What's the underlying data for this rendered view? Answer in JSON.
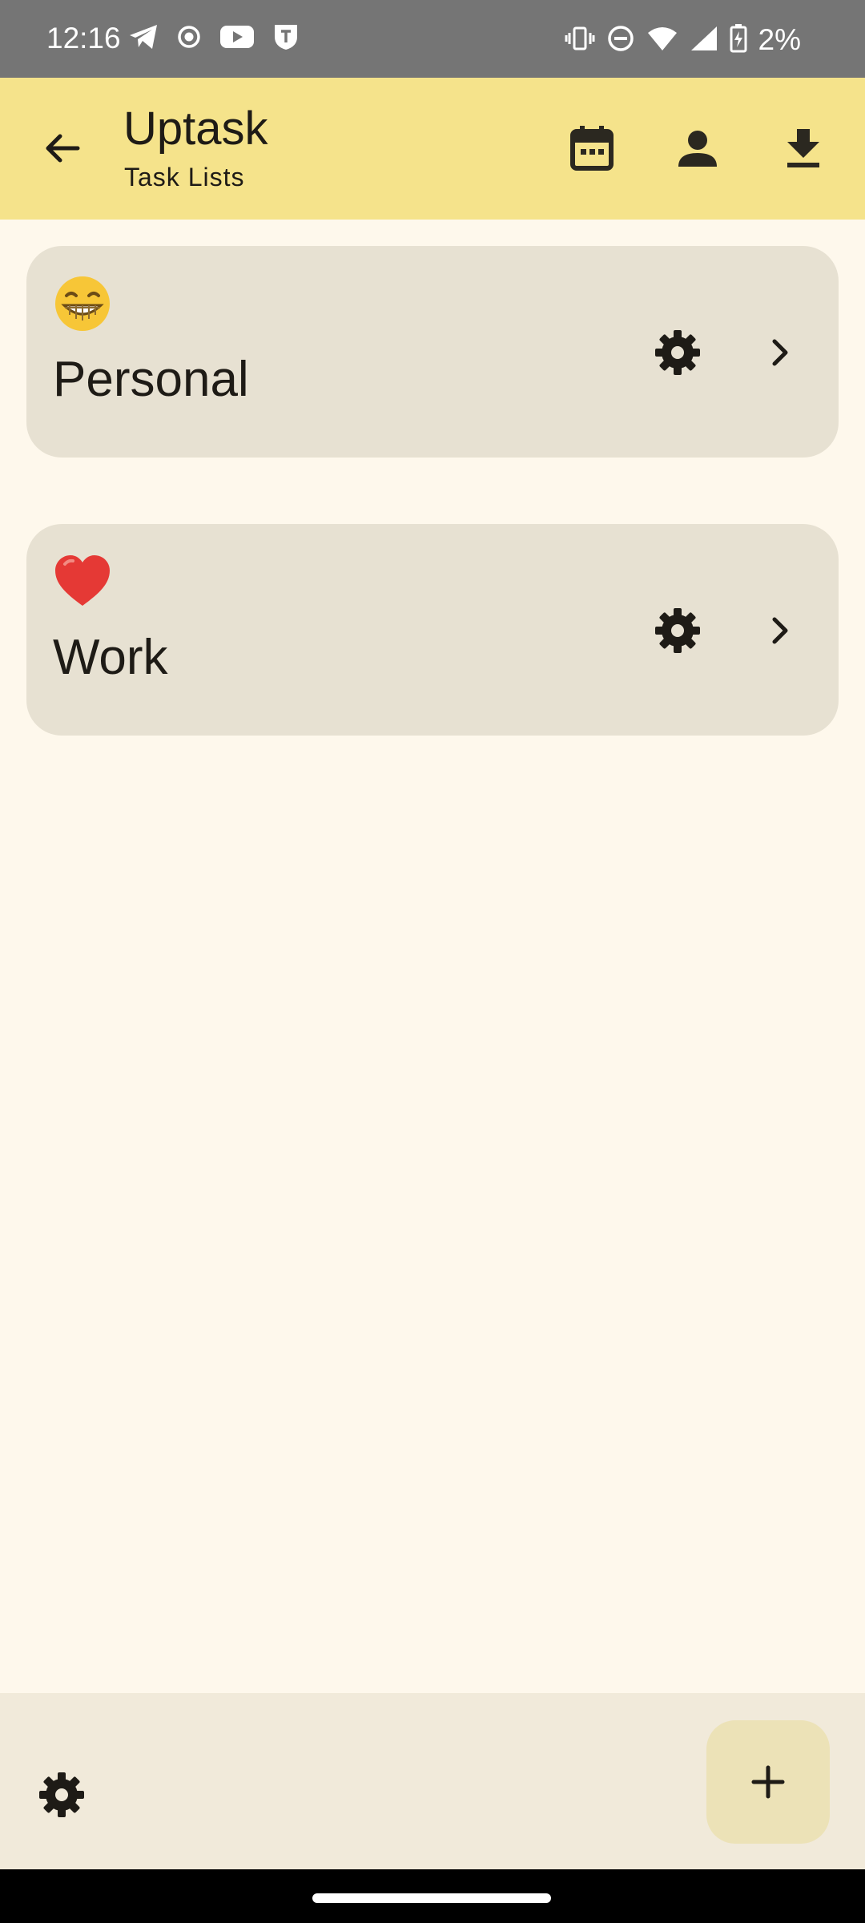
{
  "status_bar": {
    "time": "12:16",
    "battery": "2%",
    "left_icons": [
      "telegram-icon",
      "record-icon",
      "youtube-icon",
      "shield-icon"
    ],
    "right_icons": [
      "vibrate-icon",
      "do-not-disturb-icon",
      "wifi-icon",
      "signal-icon",
      "battery-charging-icon"
    ]
  },
  "app_bar": {
    "title": "Uptask",
    "subtitle": "Task Lists",
    "actions": [
      "calendar-icon",
      "person-icon",
      "download-icon"
    ]
  },
  "task_lists": [
    {
      "emoji": "grinning-face-emoji",
      "label": "Personal"
    },
    {
      "emoji": "red-heart-emoji",
      "label": "Work"
    }
  ],
  "colors": {
    "app_bar": "#F5E38B",
    "background": "#FEF8EC",
    "card": "#E7E1D2",
    "bottom_bar": "#F1EADA",
    "fab": "#ECE2B7",
    "status_bar": "#757575"
  }
}
